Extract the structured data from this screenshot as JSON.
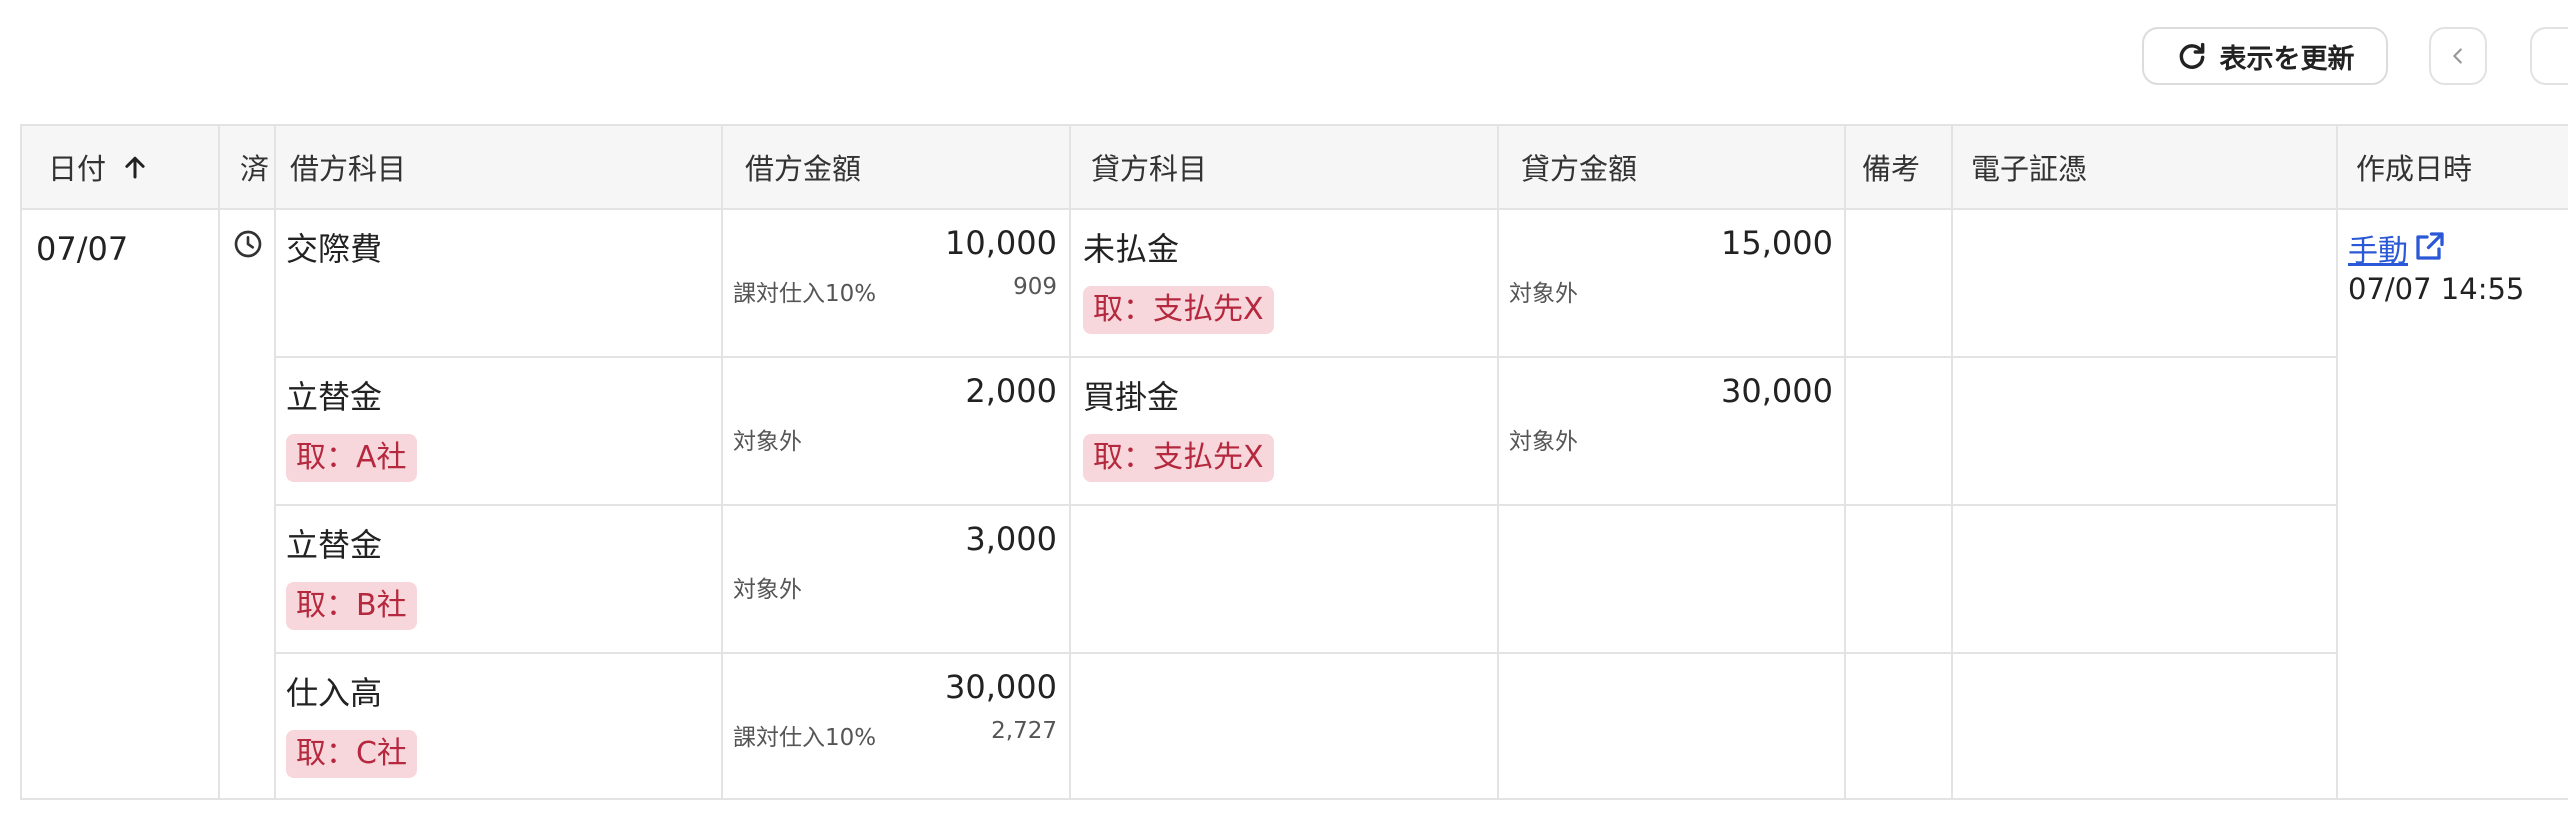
{
  "toolbar": {
    "refresh_label": "表示を更新"
  },
  "columns": {
    "date": "日付",
    "done": "済",
    "debit_account": "借方科目",
    "debit_amount": "借方金額",
    "credit_account": "貸方科目",
    "credit_amount": "貸方金額",
    "memo": "備考",
    "evidence": "電子証憑",
    "created_at": "作成日時"
  },
  "entry": {
    "date": "07/07",
    "source": "手動",
    "created_at": "07/07 14:55",
    "lines": [
      {
        "debit_account": "交際費",
        "debit_partner": "",
        "debit_amount": "10,000",
        "debit_tax": "課対仕入10%",
        "debit_tax_amount": "909",
        "credit_account": "未払金",
        "credit_partner": "取：支払先X",
        "credit_amount": "15,000",
        "credit_tax": "対象外"
      },
      {
        "debit_account": "立替金",
        "debit_partner": "取：A社",
        "debit_amount": "2,000",
        "debit_tax": "対象外",
        "debit_tax_amount": "",
        "credit_account": "買掛金",
        "credit_partner": "取：支払先X",
        "credit_amount": "30,000",
        "credit_tax": "対象外"
      },
      {
        "debit_account": "立替金",
        "debit_partner": "取：B社",
        "debit_amount": "3,000",
        "debit_tax": "対象外",
        "debit_tax_amount": "",
        "credit_account": "",
        "credit_partner": "",
        "credit_amount": "",
        "credit_tax": ""
      },
      {
        "debit_account": "仕入高",
        "debit_partner": "取：C社",
        "debit_amount": "30,000",
        "debit_tax": "課対仕入10%",
        "debit_tax_amount": "2,727",
        "credit_account": "",
        "credit_partner": "",
        "credit_amount": "",
        "credit_tax": ""
      }
    ]
  },
  "icons": {
    "refresh": "refresh-icon",
    "prev": "chevron-left-icon",
    "sort": "arrow-up-icon",
    "status": "clock-icon",
    "external": "external-link-icon"
  },
  "colors": {
    "tag_bg": "#f7d7dc",
    "tag_text": "#b5283e",
    "link": "#2a58d6"
  }
}
